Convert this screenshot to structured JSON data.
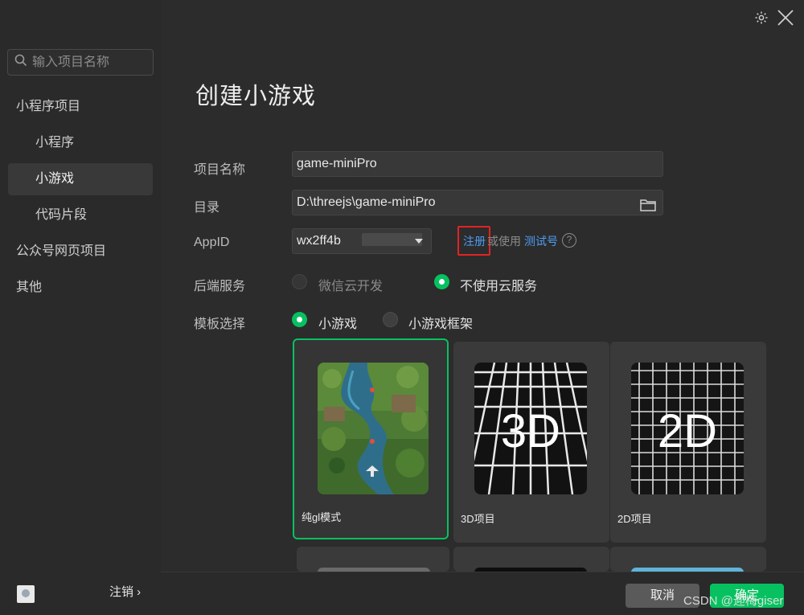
{
  "sidebar": {
    "search_placeholder": "输入项目名称",
    "items": [
      {
        "label": "小程序项目"
      },
      {
        "label": "小程序"
      },
      {
        "label": "小游戏"
      },
      {
        "label": "代码片段"
      },
      {
        "label": "公众号网页项目"
      },
      {
        "label": "其他"
      }
    ],
    "logout_label": "注销 ›"
  },
  "main": {
    "title": "创建小游戏",
    "project_name": {
      "label": "项目名称",
      "value": "game-miniPro"
    },
    "directory": {
      "label": "目录",
      "value": "D:\\threejs\\game-miniPro"
    },
    "appid": {
      "label": "AppID",
      "value": "wx2ff4b",
      "register_link": "注册",
      "or_use": "或使用",
      "test_link": "测试号",
      "help": "?"
    },
    "backend": {
      "label": "后端服务",
      "options": [
        {
          "label": "微信云开发",
          "selected": false
        },
        {
          "label": "不使用云服务",
          "selected": true
        }
      ]
    },
    "template": {
      "label": "模板选择",
      "options": [
        {
          "label": "小游戏",
          "selected": true
        },
        {
          "label": "小游戏框架",
          "selected": false
        }
      ]
    },
    "cards": [
      {
        "label": "纯gl模式",
        "selected": true
      },
      {
        "label": "3D项目",
        "thumb_text": "3D",
        "selected": false
      },
      {
        "label": "2D项目",
        "thumb_text": "2D",
        "selected": false
      }
    ]
  },
  "footer": {
    "cancel_label": "取消",
    "confirm_label": "确定"
  },
  "watermark": "CSDN @迎梅giser",
  "colors": {
    "accent": "#07c160",
    "link": "#4e9df2",
    "highlight": "#e02424"
  }
}
